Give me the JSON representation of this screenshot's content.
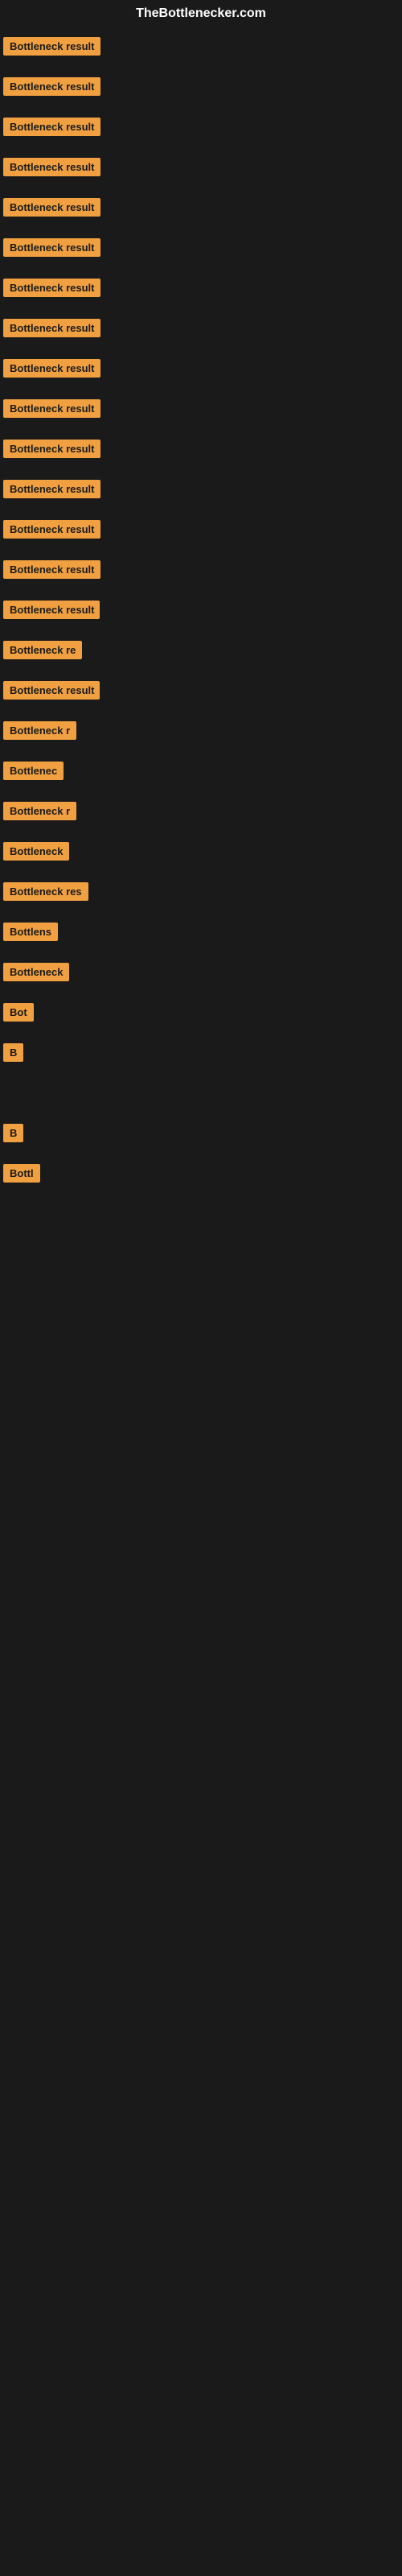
{
  "header": {
    "title": "TheBottlenecker.com"
  },
  "items": [
    {
      "label": "Bottleneck result",
      "width": 120
    },
    {
      "label": "Bottleneck result",
      "width": 120
    },
    {
      "label": "Bottleneck result",
      "width": 120
    },
    {
      "label": "Bottleneck result",
      "width": 120
    },
    {
      "label": "Bottleneck result",
      "width": 120
    },
    {
      "label": "Bottleneck result",
      "width": 120
    },
    {
      "label": "Bottleneck result",
      "width": 120
    },
    {
      "label": "Bottleneck result",
      "width": 120
    },
    {
      "label": "Bottleneck result",
      "width": 120
    },
    {
      "label": "Bottleneck result",
      "width": 120
    },
    {
      "label": "Bottleneck result",
      "width": 120
    },
    {
      "label": "Bottleneck result",
      "width": 120
    },
    {
      "label": "Bottleneck result",
      "width": 110
    },
    {
      "label": "Bottleneck result",
      "width": 105
    },
    {
      "label": "Bottleneck result",
      "width": 100
    },
    {
      "label": "Bottleneck re",
      "width": 90
    },
    {
      "label": "Bottleneck result",
      "width": 100
    },
    {
      "label": "Bottleneck r",
      "width": 82
    },
    {
      "label": "Bottlenec",
      "width": 72
    },
    {
      "label": "Bottleneck r",
      "width": 82
    },
    {
      "label": "Bottleneck",
      "width": 72
    },
    {
      "label": "Bottleneck res",
      "width": 90
    },
    {
      "label": "Bottlens",
      "width": 62
    },
    {
      "label": "Bottleneck",
      "width": 72
    },
    {
      "label": "Bot",
      "width": 36
    },
    {
      "label": "B",
      "width": 16
    },
    {
      "label": "",
      "width": 0
    },
    {
      "label": "B",
      "width": 16
    },
    {
      "label": "Bottl",
      "width": 40
    },
    {
      "label": "",
      "width": 0
    },
    {
      "label": "",
      "width": 0
    },
    {
      "label": "",
      "width": 0
    },
    {
      "label": "",
      "width": 0
    },
    {
      "label": "",
      "width": 0
    },
    {
      "label": "",
      "width": 0
    },
    {
      "label": "",
      "width": 0
    }
  ]
}
